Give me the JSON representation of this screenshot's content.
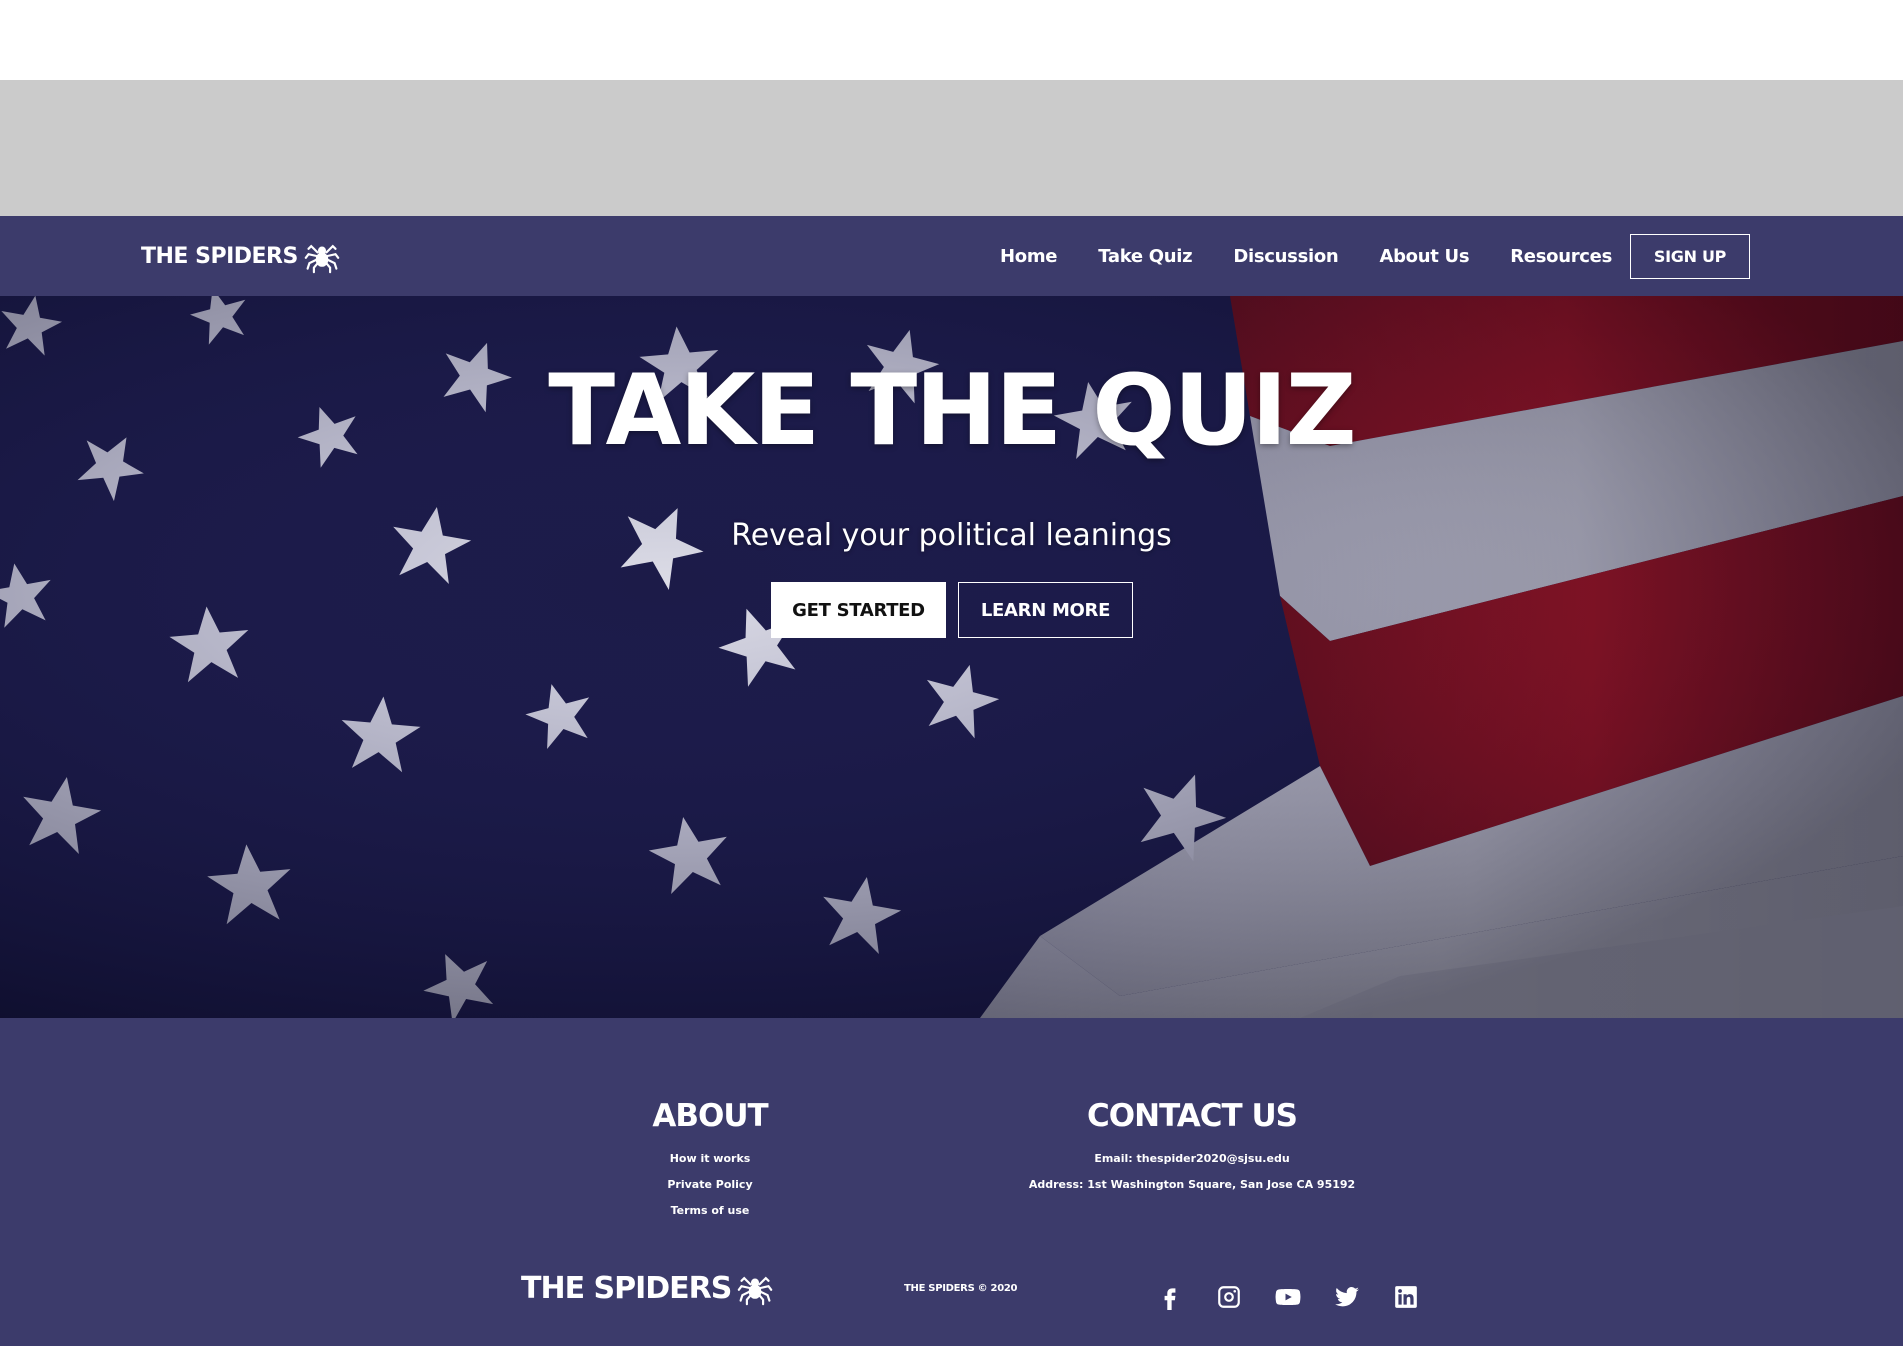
{
  "nav": {
    "brand": "THE SPIDERS",
    "links": [
      "Home",
      "Take Quiz",
      "Discussion",
      "About Us",
      "Resources"
    ],
    "signup_label": "SIGN UP"
  },
  "hero": {
    "title": "TAKE THE QUIZ",
    "subtitle": "Reveal your political leanings",
    "primary_button": "GET STARTED",
    "secondary_button": "LEARN MORE"
  },
  "footer": {
    "about": {
      "heading": "ABOUT",
      "links": [
        "How it works",
        "Private Policy",
        "Terms of use"
      ]
    },
    "contact": {
      "heading": "CONTACT US",
      "email": "Email: thespider2020@sjsu.edu",
      "address": "Address: 1st Washington Square, San Jose CA 95192"
    },
    "brand": "THE SPIDERS",
    "copyright": "THE SPIDERS © 2020",
    "socials": [
      "facebook-icon",
      "instagram-icon",
      "youtube-icon",
      "twitter-icon",
      "linkedin-icon"
    ]
  },
  "colors": {
    "navy": "#3c3b6b",
    "band_gray": "#cbcbcb",
    "flag_blue": "#1c1b48",
    "flag_red": "#b0121a"
  }
}
